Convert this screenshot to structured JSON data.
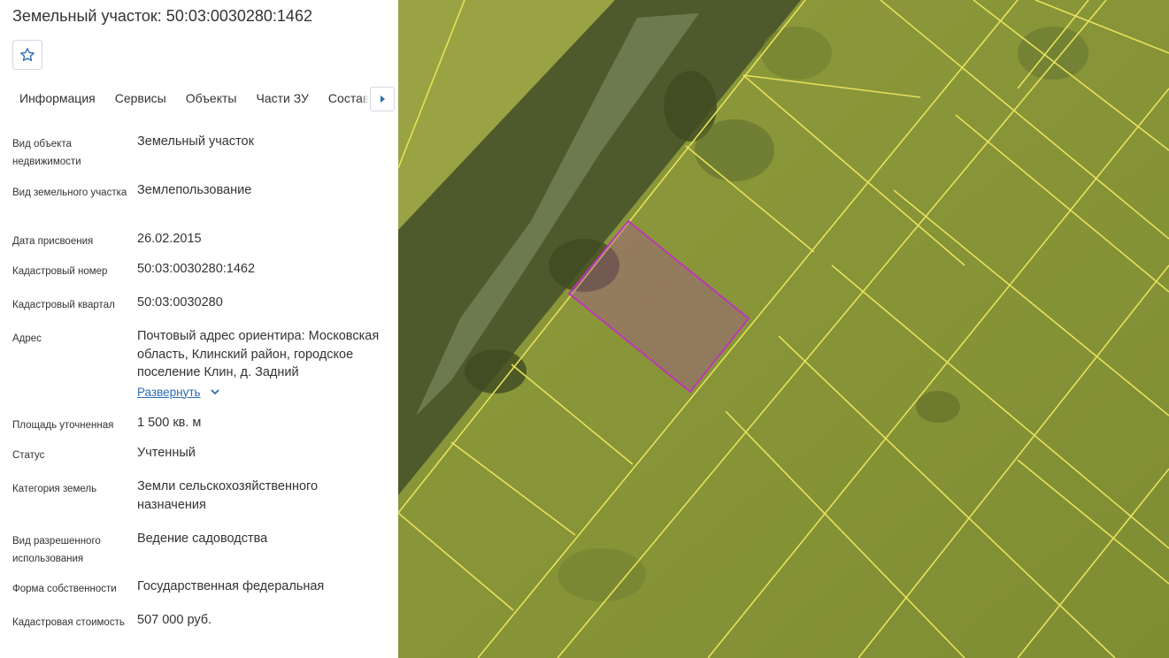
{
  "header": {
    "title": "Земельный участок: 50:03:0030280:1462"
  },
  "favorite": {
    "icon": "star-outline-icon"
  },
  "tabs": [
    "Информация",
    "Сервисы",
    "Объекты",
    "Части ЗУ",
    "Состав"
  ],
  "active_tab": "Информация",
  "tab_scroll_icon": "caret-right-icon",
  "info": {
    "object_type_label": "Вид объекта недвижимости",
    "object_type": "Земельный участок",
    "land_type_label": "Вид земельного участка",
    "land_type": "Землепользование",
    "date_label": "Дата присвоения",
    "date": "26.02.2015",
    "cad_number_label": "Кадастровый номер",
    "cad_number": "50:03:0030280:1462",
    "cad_quarter_label": "Кадастровый квартал",
    "cad_quarter": "50:03:0030280",
    "address_label": "Адрес",
    "address": "Почтовый адрес ориентира: Московская область, Клинский район, городское поселение Клин, д. Задний",
    "expand_label": "Развернуть",
    "area_label": "Площадь уточненная",
    "area": "1 500 кв. м",
    "status_label": "Статус",
    "status": "Учтенный",
    "category_label": "Категория земель",
    "category": "Земли сельскохозяйственного назначения",
    "permitted_use_label": "Вид разрешенного использования",
    "permitted_use": "Ведение садоводства",
    "ownership_label": "Форма собственности",
    "ownership": "Государственная федеральная",
    "cost_label": "Кадастровая стоимость",
    "cost": "507 000 руб."
  },
  "map": {
    "parcel_outline_color": "#c030c0",
    "boundary_color": "#e6e05a",
    "grass_color": "#8a9a3a",
    "forest_color": "#4a5a2a"
  }
}
